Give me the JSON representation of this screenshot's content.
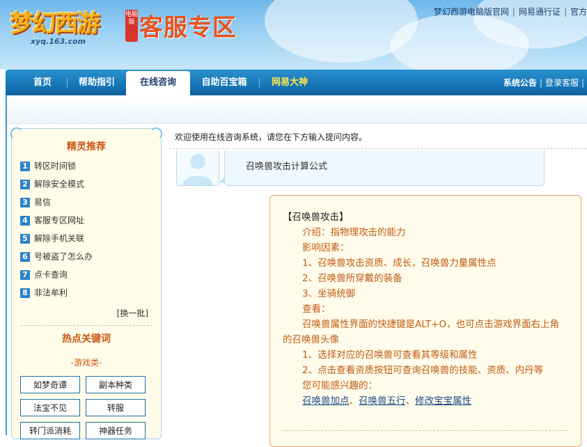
{
  "header": {
    "logo_text": "梦幻西游",
    "logo_badge": "电脑版",
    "logo_url": "xyq.163.com",
    "site_title": "客服专区",
    "top_links": [
      "梦幻西游电脑版官网",
      "网易通行证",
      "官方"
    ]
  },
  "nav": {
    "items": [
      "首页",
      "帮助指引",
      "在线咨询",
      "自助百宝箱",
      "网易大神"
    ],
    "active": "在线咨询",
    "right_links": [
      "系统公告",
      "登录客服"
    ]
  },
  "sidebar": {
    "recommend_title": "精灵推荐",
    "recommend_items": [
      {
        "num": "1",
        "label": "转区时间锁"
      },
      {
        "num": "2",
        "label": "解除安全模式"
      },
      {
        "num": "3",
        "label": "易信"
      },
      {
        "num": "4",
        "label": "客服专区网址"
      },
      {
        "num": "5",
        "label": "解除手机关联"
      },
      {
        "num": "6",
        "label": "号被盗了怎么办"
      },
      {
        "num": "7",
        "label": "点卡查询"
      },
      {
        "num": "8",
        "label": "非法牟利"
      }
    ],
    "refresh_label": "[换一批]",
    "hot_title": "热点关键词",
    "category_label": "-游戏类-",
    "keywords": [
      "如梦奇谭",
      "副本种类",
      "法宝不见",
      "转服",
      "转门派消耗",
      "神器任务"
    ]
  },
  "main": {
    "welcome": "欢迎使用在线咨询系统，请您在下方输入提问内容。",
    "question": "召唤兽攻击计算公式",
    "answer": {
      "title": "【召唤兽攻击】",
      "intro": "介绍：指物理攻击的能力",
      "factors_label": "影响因素：",
      "factor_1": "1、召唤兽攻击资质、成长，召唤兽力量属性点",
      "factor_2": "2、召唤兽所穿戴的装备",
      "factor_3": "3、坐骑统御",
      "check_label": "查看：",
      "check_text": "召唤兽属性界面的快捷键是ALT+O，也可点击游戏界面右上角的召唤兽头像",
      "check_1": "1、选择对应的召唤兽可查看其等级和属性",
      "check_2": "2、点击查看资质按钮可查询召唤兽的技能、资质、内丹等",
      "interest_label": "您可能感兴趣的：",
      "links": [
        "召唤兽加点",
        "召唤兽五行",
        "修改宝宝属性"
      ],
      "link_sep": "、"
    }
  },
  "colors": {
    "nav_blue": "#1676b6",
    "accent_orange": "#c25a12",
    "link_blue": "#1f4f8a"
  }
}
